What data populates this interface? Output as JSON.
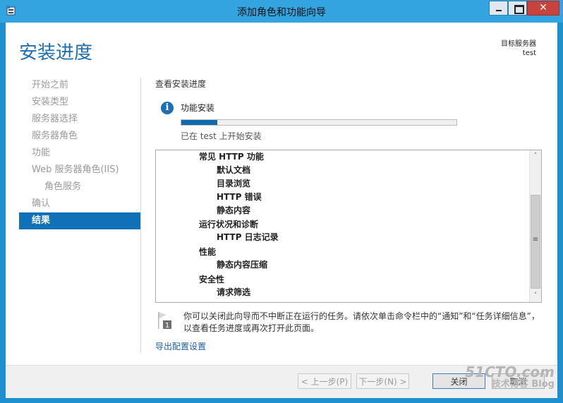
{
  "window": {
    "title": "添加角色和功能向导",
    "close_glyph": "✕"
  },
  "wizard": {
    "title": "安装进度",
    "target_label": "目标服务器",
    "target_value": "test"
  },
  "nav": {
    "items": [
      {
        "label": "开始之前",
        "state": "disabled"
      },
      {
        "label": "安装类型",
        "state": "disabled"
      },
      {
        "label": "服务器选择",
        "state": "disabled"
      },
      {
        "label": "服务器角色",
        "state": "disabled"
      },
      {
        "label": "功能",
        "state": "disabled"
      },
      {
        "label": "Web 服务器角色(IIS)",
        "state": "disabled"
      },
      {
        "label": "角色服务",
        "state": "disabled"
      },
      {
        "label": "确认",
        "state": "disabled"
      },
      {
        "label": "结果",
        "state": "active"
      }
    ]
  },
  "main": {
    "section_heading": "查看安装进度",
    "status_icon": "info-icon",
    "status_title": "功能安装",
    "progress_percent": 13,
    "progress_text": "已在 test 上开始安装",
    "features": [
      {
        "label": "常见 HTTP 功能",
        "level": 1
      },
      {
        "label": "默认文档",
        "level": 2
      },
      {
        "label": "目录浏览",
        "level": 2
      },
      {
        "label": "HTTP 错误",
        "level": 2
      },
      {
        "label": "静态内容",
        "level": 2
      },
      {
        "label": "运行状况和诊断",
        "level": 1
      },
      {
        "label": "HTTP 日志记录",
        "level": 2
      },
      {
        "label": "性能",
        "level": 1
      },
      {
        "label": "静态内容压缩",
        "level": 2
      },
      {
        "label": "安全性",
        "level": 1
      },
      {
        "label": "请求筛选",
        "level": 2
      }
    ],
    "note_text": "你可以关闭此向导而不中断正在运行的任务。请依次单击命令栏中的“通知”和“任务详细信息”，以查看任务进度或再次打开此页面。",
    "note_icon_badge": "1",
    "export_link": "导出配置设置"
  },
  "footer": {
    "prev": "< 上一步(P)",
    "next": "下一步(N) >",
    "close": "关闭",
    "cancel": "取消"
  },
  "watermark": {
    "line1": "51CTO.com",
    "line2": "技术博客  Blog"
  },
  "colors": {
    "titlebar": "#33a4e0",
    "accent": "#1070b8",
    "title_text": "#1f6fb2",
    "close_button": "#c7433c"
  }
}
